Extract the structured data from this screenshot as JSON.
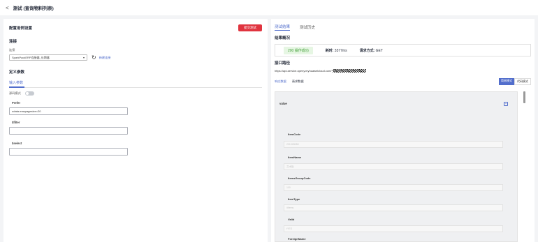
{
  "header": {
    "back_glyph": "<",
    "title": "测试 (查询物料列表)"
  },
  "left": {
    "title": "配置用例设置",
    "submit_label": "提交测试",
    "connection": {
      "section": "连接",
      "field_label": "连接",
      "selected": "SparkPackERP连接器_长期器",
      "new_link": "新建连接"
    },
    "params": {
      "section": "定义参数",
      "tab": "输入参数",
      "mode_label": "源码模式",
      "fields": [
        {
          "label": "Prefer",
          "value": "odata.maxpagesize=20"
        },
        {
          "label": "$filter",
          "value": ""
        },
        {
          "label": "$select",
          "value": ""
        }
      ]
    }
  },
  "right": {
    "tabs": [
      "测试结果",
      "测试历史"
    ],
    "summary": {
      "section": "结果概况",
      "status": "200 操作成功",
      "time_label": "耗时:",
      "time_value": "3377ms",
      "method_label": "请求方式:",
      "method_value": "GET"
    },
    "endpoint": {
      "section": "接口路径",
      "url": "https://api-service.openy.myhuaweicloud.com/"
    },
    "body_tabs": [
      "响应数据",
      "请求数据"
    ],
    "view_modes": [
      "简易模式",
      "代码模式"
    ],
    "viewer": {
      "root": "value",
      "items": [
        {
          "label": "ItemCode",
          "value": "20102808K"
        },
        {
          "label": "ItemName",
          "value": "艾木板"
        },
        {
          "label": "ItemsGroupCode",
          "value": "100"
        },
        {
          "label": "ItemType",
          "value": "itItems"
        },
        {
          "label": "Valid",
          "value": "tYES"
        },
        {
          "label": "ForeignName",
          "value": ""
        }
      ]
    }
  }
}
